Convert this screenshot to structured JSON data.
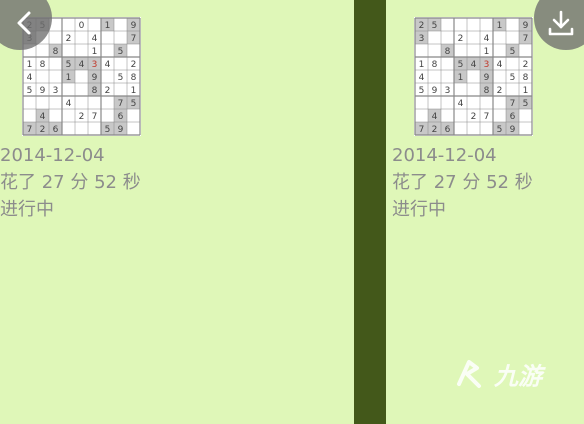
{
  "colors": {
    "background": "#dff7b8",
    "divider": "#43581a",
    "meta_text": "#8c8c8c",
    "fab": "#6e6e6e"
  },
  "icons": {
    "back": "chevron-left-icon",
    "download": "download-icon",
    "watermark": "jiuyou-logo-icon"
  },
  "cards": [
    {
      "date": "2014-12-04",
      "duration": "花了 27 分 52 秒",
      "status": "进行中",
      "grid": [
        "25__0_1_9",
        "3__2_4__7",
        "__8__1_5_",
        "18_5434_2",
        "4__1_9_58",
        "593__82_1",
        "___4___75",
        "_4__27_6_",
        "726___59_"
      ]
    },
    {
      "date": "2014-12-04",
      "duration": "花了 27 分 52 秒",
      "status": "进行中",
      "grid": [
        "25____1_9",
        "3__2_4__7",
        "__8__1_5_",
        "18_5434_2",
        "4__1_9_58",
        "593__82_1",
        "___4___75",
        "_4__27_6_",
        "726___59_"
      ]
    }
  ],
  "watermark_text": "九游"
}
